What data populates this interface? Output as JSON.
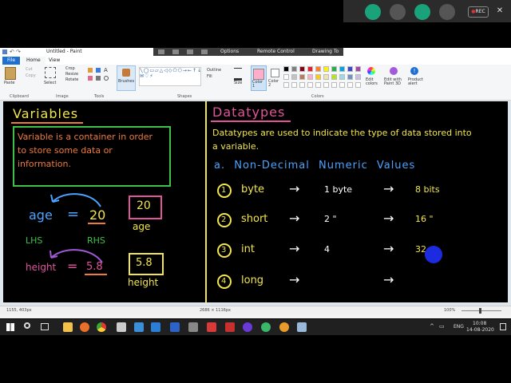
{
  "window": {
    "title": "Untitled - Paint",
    "remote_menu": [
      "Options",
      "Remote Control",
      "Drawing To"
    ]
  },
  "menu": {
    "tabs": [
      "File",
      "Home",
      "View"
    ]
  },
  "ribbon": {
    "groups": [
      "Clipboard",
      "Image",
      "Tools",
      "Shapes",
      "Colors"
    ],
    "clipboard": {
      "paste": "Paste",
      "cut": "Cut",
      "copy": "Copy"
    },
    "image": {
      "select": "Select",
      "crop": "Crop",
      "resize": "Resize",
      "rotate": "Rotate"
    },
    "brushes": "Brushes",
    "shapes": {
      "outline": "Outline",
      "fill": "Fill"
    },
    "size": "Size",
    "color1": "Color 1",
    "color2": "Color 2",
    "edit_colors": "Edit colors",
    "edit_paint3d": "Edit with Paint 3D",
    "product_alert": "Product alert",
    "palette": [
      "#000000",
      "#7f7f7f",
      "#880015",
      "#ed1c24",
      "#ff7f27",
      "#fff200",
      "#22b14c",
      "#00a2e8",
      "#3f48cc",
      "#a349a4",
      "#ffffff",
      "#c3c3c3",
      "#b97a57",
      "#ffaec9",
      "#ffc90e",
      "#efe4b0",
      "#b5e61d",
      "#99d9ea",
      "#7092be",
      "#c8bfe7"
    ]
  },
  "meeting": {
    "rec": "REC"
  },
  "status": {
    "position": "1155, 403px",
    "size": "2686 × 1116px",
    "zoom": "100%"
  },
  "taskbar": {
    "time": "10:08",
    "date": "14-08-2020",
    "lang": "ENG"
  },
  "board": {
    "left": {
      "title": "Variables",
      "definition": [
        "Variable is a container in order",
        "to store some data or",
        "information."
      ],
      "age_var": "age",
      "equals": "=",
      "age_val": "20",
      "lhs": "LHS",
      "rhs": "RHS",
      "box1_val": "20",
      "box1_name": "age",
      "height_var": "height",
      "height_val": "5.8",
      "box2_val": "5.8",
      "box2_name": "height"
    },
    "right": {
      "title": "Datatypes",
      "description": [
        "Datatypes are used to indicate the type of data stored into",
        "a variable."
      ],
      "section": "a. Non-Decimal Numeric Values",
      "rows": [
        {
          "num": "1",
          "name": "byte",
          "arrow1": "→",
          "size": "1 byte",
          "arrow2": "→",
          "bits": "8 bits"
        },
        {
          "num": "2",
          "name": "short",
          "arrow1": "→",
          "size": "2 \"",
          "arrow2": "→",
          "bits": "16 \""
        },
        {
          "num": "3",
          "name": "int",
          "arrow1": "→",
          "size": "4",
          "arrow2": "→",
          "bits": "32"
        },
        {
          "num": "4",
          "name": "long",
          "arrow1": "→",
          "size": "",
          "arrow2": "→",
          "bits": ""
        }
      ]
    }
  },
  "colors": {
    "green": "#3ec14a",
    "yellow": "#f2e64b",
    "orange": "#f07a3a",
    "blue_text": "#4aa3ff",
    "pink": "#e0559a",
    "purple": "#a05ad8",
    "cursor": "#1d2be0"
  }
}
